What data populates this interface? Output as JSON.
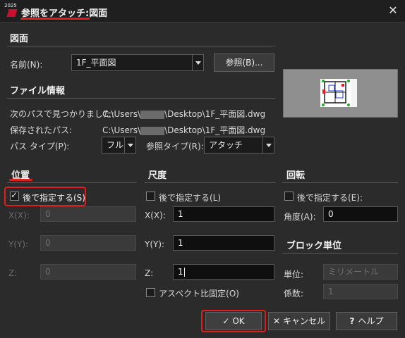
{
  "window": {
    "badge": "2025",
    "title": "参照をアタッチ:図面",
    "close": "✕"
  },
  "drawing": {
    "section": "図面",
    "name_label": "名前(N):",
    "name_value": "1F_平面図",
    "browse_label": "参照(B)..."
  },
  "file_info": {
    "section": "ファイル情報",
    "found_label": "次のパスで見つかりました:",
    "found_value_prefix": "C:\\Users\\",
    "found_value_suffix": "\\Desktop\\1F_平面図.dwg",
    "saved_label": "保存されたパス:",
    "saved_value_prefix": "C:\\Users\\",
    "saved_value_suffix": "\\Desktop\\1F_平面図.dwg",
    "path_type_label": "パス タイプ(P):",
    "path_type_value": "フル",
    "ref_type_label": "参照タイプ(R):",
    "ref_type_value": "アタッチ"
  },
  "position": {
    "section": "位置",
    "specify_label": "後で指定する(S)",
    "specify_checked": true,
    "x_label": "X(X):",
    "x_value": "0",
    "y_label": "Y(Y):",
    "y_value": "0",
    "z_label": "Z:",
    "z_value": "0"
  },
  "scale": {
    "section": "尺度",
    "specify_label": "後で指定する(L)",
    "specify_checked": false,
    "x_label": "X(X):",
    "x_value": "1",
    "y_label": "Y(Y):",
    "y_value": "1",
    "z_label": "Z:",
    "z_value": "1",
    "uniform_label": "アスペクト比固定(O)",
    "uniform_checked": false
  },
  "rotation": {
    "section": "回転",
    "specify_label": "後で指定する(E):",
    "specify_checked": false,
    "angle_label": "角度(A):",
    "angle_value": "0"
  },
  "block_unit": {
    "section": "ブロック単位",
    "unit_label": "単位:",
    "unit_value": "ミリメートル",
    "factor_label": "係数:",
    "factor_value": "1"
  },
  "buttons": {
    "ok": "OK",
    "cancel": "キャンセル",
    "help": "ヘルプ"
  },
  "colors": {
    "highlight": "#e01e1e",
    "background": "#2b2b2b",
    "titlebar": "#1f1f1f"
  }
}
